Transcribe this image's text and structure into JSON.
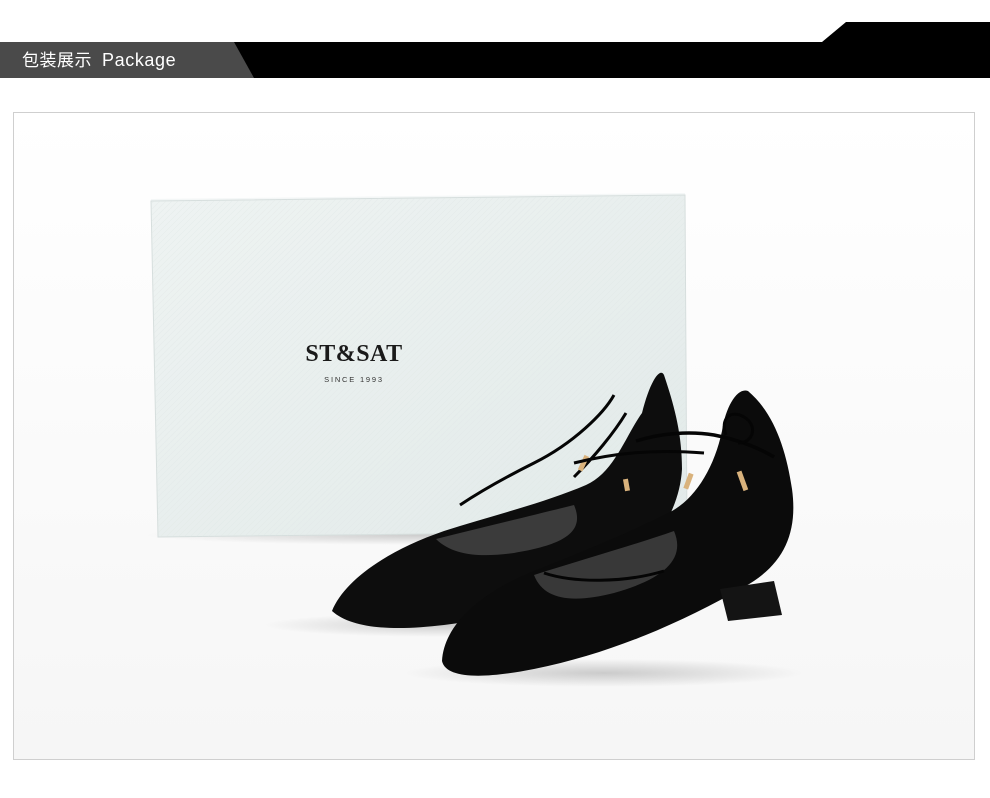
{
  "section_header": {
    "title_cn": "包装展示",
    "title_en": "Package",
    "colors": {
      "bar": "#000000",
      "tab": "#4a4a4a",
      "text": "#ffffff"
    }
  },
  "photo": {
    "subject": "shoe-box-and-black-suede-lace-up-flats",
    "box": {
      "brand": "ST&SAT",
      "since": "SINCE 1993"
    }
  }
}
